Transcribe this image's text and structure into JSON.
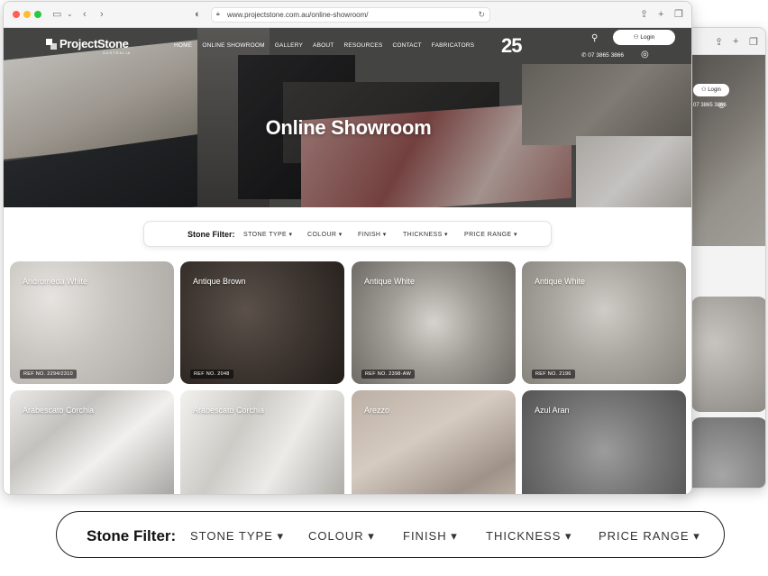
{
  "browser": {
    "url": "www.projectstone.com.au/online-showroom/"
  },
  "site": {
    "logo": "ProjectStone",
    "logo_sub": "AUSTRALIA",
    "nav": [
      "HOME",
      "ONLINE SHOWROOM",
      "GALLERY",
      "ABOUT",
      "RESOURCES",
      "CONTACT",
      "FABRICATORS"
    ],
    "badge": "25",
    "login_label": "Login",
    "phone": "07 3865 3866"
  },
  "hero": {
    "title": "Online Showroom"
  },
  "filter": {
    "label": "Stone Filter:",
    "options": [
      "STONE TYPE",
      "COLOUR",
      "FINISH",
      "THICKNESS",
      "PRICE RANGE"
    ]
  },
  "stones": [
    {
      "name": "Andromeda White",
      "ref": "REF NO. 2294/2310"
    },
    {
      "name": "Antique Brown",
      "ref": "REF NO. 2048"
    },
    {
      "name": "Antique White",
      "ref": "REF NO. 2398-AW"
    },
    {
      "name": "Antique White",
      "ref": "REF NO. 2196"
    },
    {
      "name": "Arabescato Corchia",
      "ref": ""
    },
    {
      "name": "Arabescato Corchia",
      "ref": ""
    },
    {
      "name": "Arezzo",
      "ref": ""
    },
    {
      "name": "Azul Aran",
      "ref": ""
    }
  ],
  "back_window": {
    "login_label": "Login",
    "phone": "07 3865 3866"
  },
  "colors": {
    "accent": "#222222",
    "window_bg": "#f5f5f5"
  }
}
